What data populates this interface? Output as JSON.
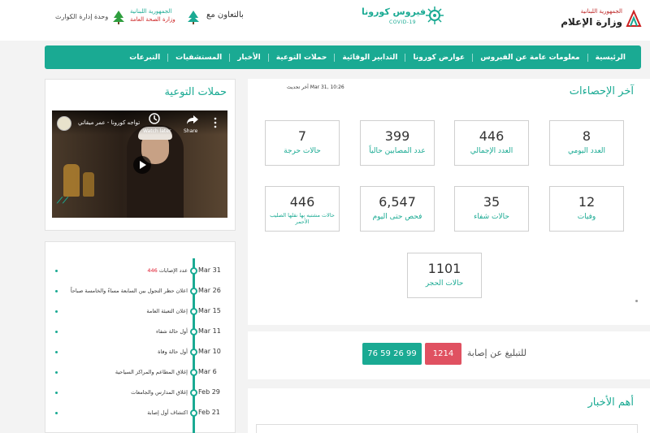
{
  "header": {
    "ministry_line1": "الجمهورية اللبنانية",
    "ministry_line2": "وزارة الإعلام",
    "virus_title": "فيروس كورونا",
    "virus_sub": "COVID-19",
    "cooperation": "بالتعاون مع",
    "moph_line1": "الجمهورية اللبنانية",
    "moph_line2": "وزارة الصحة العامة",
    "drm": "وحدة إدارة الكوارث"
  },
  "nav": {
    "items": [
      "الرئيسية",
      "معلومات عامة عن الفيروس",
      "عوارض كورونا",
      "التدابير الوقائية",
      "حملات التوعية",
      "الأخبار",
      "المستشفيات",
      "التبرعات"
    ]
  },
  "stats": {
    "title": "آخر الإحصاءات",
    "updated": "آخر تحديث Mar 31, 10:26",
    "boxes": [
      {
        "num": "8",
        "label": "العدد اليومي"
      },
      {
        "num": "446",
        "label": "العدد الإجمالي"
      },
      {
        "num": "399",
        "label": "عدد المصابين حالياً"
      },
      {
        "num": "7",
        "label": "حالات حرجة"
      },
      {
        "num": "12",
        "label": "وفيات"
      },
      {
        "num": "35",
        "label": "حالات شفاء"
      },
      {
        "num": "6,547",
        "label": "فحص حتى اليوم"
      },
      {
        "num": "446",
        "label": "حالات مشتبه بها نقلها الصليب الأحمر"
      },
      {
        "num": "1101",
        "label": "حالات الحجر"
      }
    ]
  },
  "report": {
    "label": "للتبليغ عن إصابة",
    "hotline": "1214",
    "phone": "76 59 26 99"
  },
  "news": {
    "title": "أهم الأخبار"
  },
  "awareness": {
    "title": "حملات التوعية",
    "video_title": "تواجه كورونا - عمر ميقاتي",
    "watch_later": "Watch later",
    "share": "Share"
  },
  "timeline": {
    "items": [
      {
        "date": "Mar 31",
        "text": "عدد الإصابات",
        "highlight": "446"
      },
      {
        "date": "Mar 26",
        "text": "اعلان حظر التجول بين السابعة مساءً والخامسة صباحاً",
        "highlight": ""
      },
      {
        "date": "Mar 15",
        "text": "إعلان التعبئة العامة",
        "highlight": ""
      },
      {
        "date": "Mar 11",
        "text": "أول حالة شفاء",
        "highlight": ""
      },
      {
        "date": "Mar 10",
        "text": "أول حالة وفاة",
        "highlight": ""
      },
      {
        "date": "Mar 6",
        "text": "إغلاق المطاعم والمراكز السياحية",
        "highlight": ""
      },
      {
        "date": "Feb 29",
        "text": "إغلاق المدارس والجامعات",
        "highlight": ""
      },
      {
        "date": "Feb 21",
        "text": "اكتشاف أول إصابة",
        "highlight": ""
      }
    ]
  },
  "colors": {
    "primary": "#1aaa93",
    "alert": "#e05161",
    "background": "#f3f3f3"
  }
}
